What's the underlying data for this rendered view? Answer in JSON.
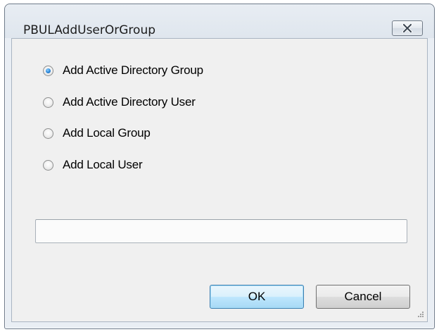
{
  "window": {
    "title": "PBULAddUserOrGroup"
  },
  "options": [
    {
      "label": "Add Active Directory Group",
      "selected": true
    },
    {
      "label": "Add Active Directory User",
      "selected": false
    },
    {
      "label": "Add Local Group",
      "selected": false
    },
    {
      "label": "Add Local User",
      "selected": false
    }
  ],
  "name_input": {
    "value": "",
    "placeholder": ""
  },
  "buttons": {
    "ok_label": "OK",
    "cancel_label": "Cancel"
  },
  "icons": {
    "close": "close-icon",
    "resize": "resize-grip-icon"
  },
  "colors": {
    "selected_radio": "#2a86d8",
    "default_button_border": "#3c7fb1"
  }
}
